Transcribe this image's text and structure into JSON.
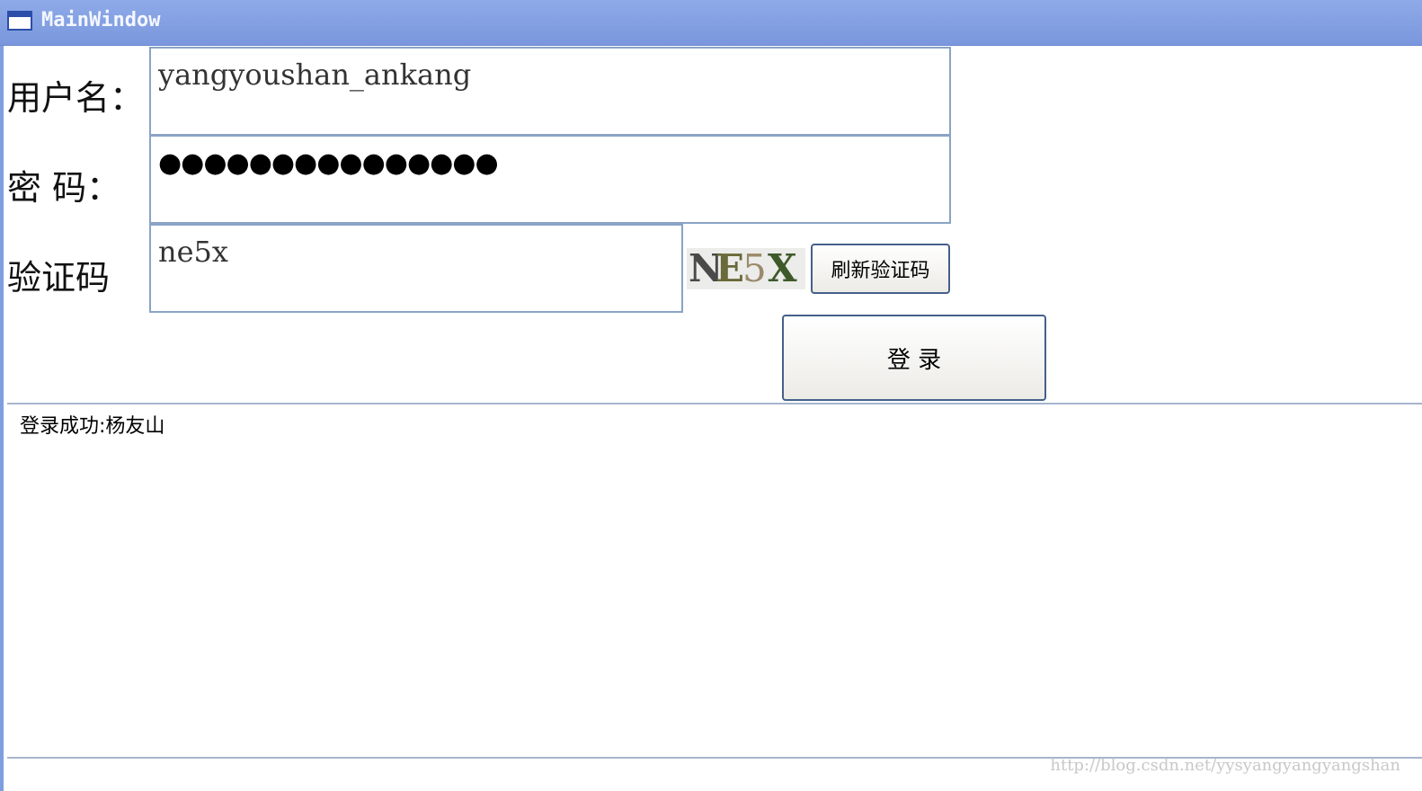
{
  "window": {
    "title": "MainWindow"
  },
  "form": {
    "username_label": "用户名：",
    "username_value": "yangyoushan_ankang",
    "password_label": "密 码：",
    "password_mask": "●●●●●●●●●●●●●●●",
    "captcha_label": "验证码",
    "captcha_value": "ne5x",
    "captcha_image_chars": [
      "N",
      "E",
      "5",
      "X"
    ],
    "refresh_button": "刷新验证码",
    "login_button": "登 录"
  },
  "output": {
    "message": "登录成功:杨友山"
  },
  "watermark": "http://blog.csdn.net/yysyangyangyangshan"
}
